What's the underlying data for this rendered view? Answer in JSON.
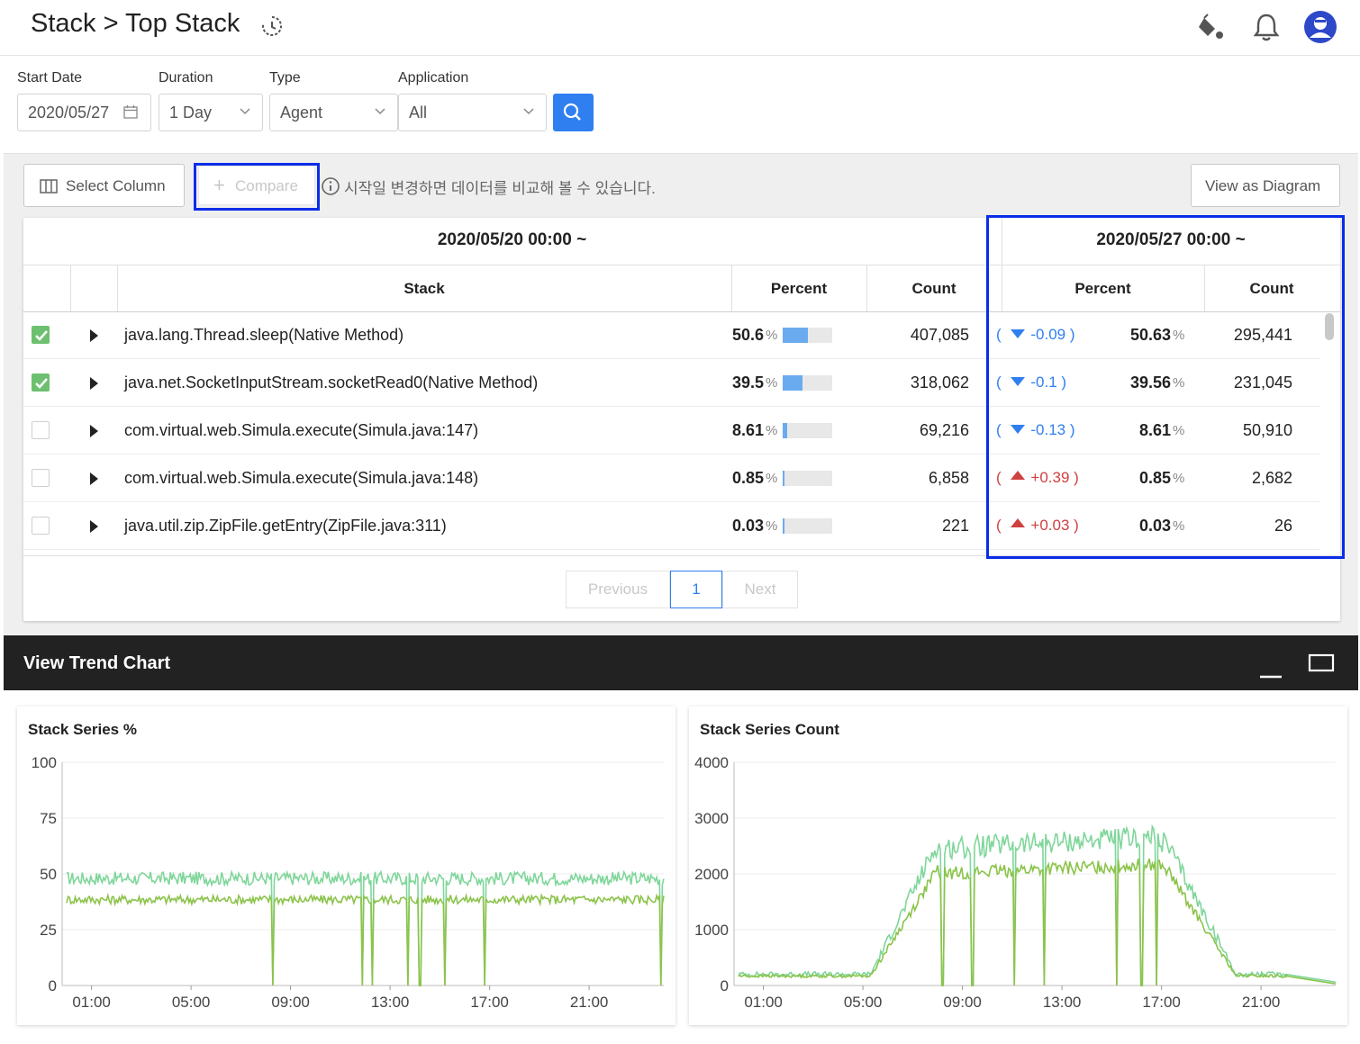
{
  "header": {
    "title": "Stack > Top Stack",
    "icons": [
      "history-icon",
      "paint-bucket-icon",
      "bell-icon",
      "user-avatar-icon"
    ]
  },
  "filters": {
    "start_date": {
      "label": "Start Date",
      "value": "2020/05/27"
    },
    "duration": {
      "label": "Duration",
      "value": "1 Day"
    },
    "type": {
      "label": "Type",
      "value": "Agent"
    },
    "application": {
      "label": "Application",
      "value": "All"
    }
  },
  "toolbar": {
    "select_column": "Select Column",
    "compare": "Compare",
    "note": "시작일 변경하면 데이터를 비교해 볼 수 있습니다.",
    "view_as_diagram": "View as Diagram"
  },
  "table": {
    "left_period": "2020/05/20 00:00 ~",
    "right_period": "2020/05/27 00:00 ~",
    "columns": {
      "stack": "Stack",
      "percent": "Percent",
      "count": "Count"
    },
    "percent_unit": "%",
    "rows": [
      {
        "checked": true,
        "stack": "java.lang.Thread.sleep(Native Method)",
        "pct": "50.6",
        "count": "407,085",
        "delta": "-0.09",
        "dir": "down",
        "pct2": "50.63",
        "count2": "295,441",
        "bar": 0.506
      },
      {
        "checked": true,
        "stack": "java.net.SocketInputStream.socketRead0(Native Method)",
        "pct": "39.5",
        "count": "318,062",
        "delta": "-0.1",
        "dir": "down",
        "pct2": "39.56",
        "count2": "231,045",
        "bar": 0.395
      },
      {
        "checked": false,
        "stack": "com.virtual.web.Simula.execute(Simula.java:147)",
        "pct": "8.61",
        "count": "69,216",
        "delta": "-0.13",
        "dir": "down",
        "pct2": "8.61",
        "count2": "50,910",
        "bar": 0.0861
      },
      {
        "checked": false,
        "stack": "com.virtual.web.Simula.execute(Simula.java:148)",
        "pct": "0.85",
        "count": "6,858",
        "delta": "+0.39",
        "dir": "up",
        "pct2": "0.85",
        "count2": "2,682",
        "bar": 0.0085
      },
      {
        "checked": false,
        "stack": "java.util.zip.ZipFile.getEntry(ZipFile.java:311)",
        "pct": "0.03",
        "count": "221",
        "delta": "+0.03",
        "dir": "up",
        "pct2": "0.03",
        "count2": "26",
        "bar": 0.0003
      }
    ]
  },
  "pagination": {
    "previous": "Previous",
    "current": "1",
    "next": "Next"
  },
  "trend": {
    "title": "View Trend Chart"
  },
  "colors": {
    "accent": "#2f7ff0",
    "highlight": "#0a2de8",
    "series_a": "#7fd69a",
    "series_b": "#8bc34a",
    "down": "#2f7ff0",
    "up": "#d04040"
  },
  "chart_data": [
    {
      "type": "line",
      "title": "Stack Series %",
      "ylim": [
        0,
        100
      ],
      "yticks": [
        "0",
        "25",
        "50",
        "75",
        "100"
      ],
      "xticks": [
        "01:00",
        "05:00",
        "09:00",
        "13:00",
        "17:00",
        "21:00"
      ],
      "x_range_hours": [
        0,
        24
      ],
      "series": [
        {
          "color": "#7fd69a",
          "level": 48,
          "noise": 3,
          "drops": [
            8.3,
            11.9,
            12.3,
            13.7,
            14.2,
            15.2,
            16.8,
            23.9
          ]
        },
        {
          "color": "#8bc34a",
          "level": 38.5,
          "noise": 2,
          "drops": [
            8.3,
            11.9,
            12.3,
            13.7,
            14.2,
            15.2,
            16.8,
            23.9
          ]
        }
      ]
    },
    {
      "type": "line",
      "title": "Stack Series Count",
      "ylim": [
        0,
        4000
      ],
      "yticks": [
        "0",
        "1000",
        "2000",
        "3000",
        "4000"
      ],
      "xticks": [
        "01:00",
        "05:00",
        "09:00",
        "13:00",
        "17:00",
        "21:00"
      ],
      "x_range_hours": [
        0,
        24
      ],
      "series": [
        {
          "color": "#7fd69a",
          "base": 200,
          "peak": 2550,
          "noise": 150,
          "drops": [
            8.2,
            9.4,
            11.1,
            12.3,
            15.2,
            16.2,
            16.8
          ]
        },
        {
          "color": "#8bc34a",
          "base": 170,
          "peak": 2080,
          "noise": 90,
          "drops": [
            8.2,
            9.4,
            11.1,
            12.3,
            15.2,
            16.2,
            16.8
          ]
        }
      ]
    }
  ]
}
